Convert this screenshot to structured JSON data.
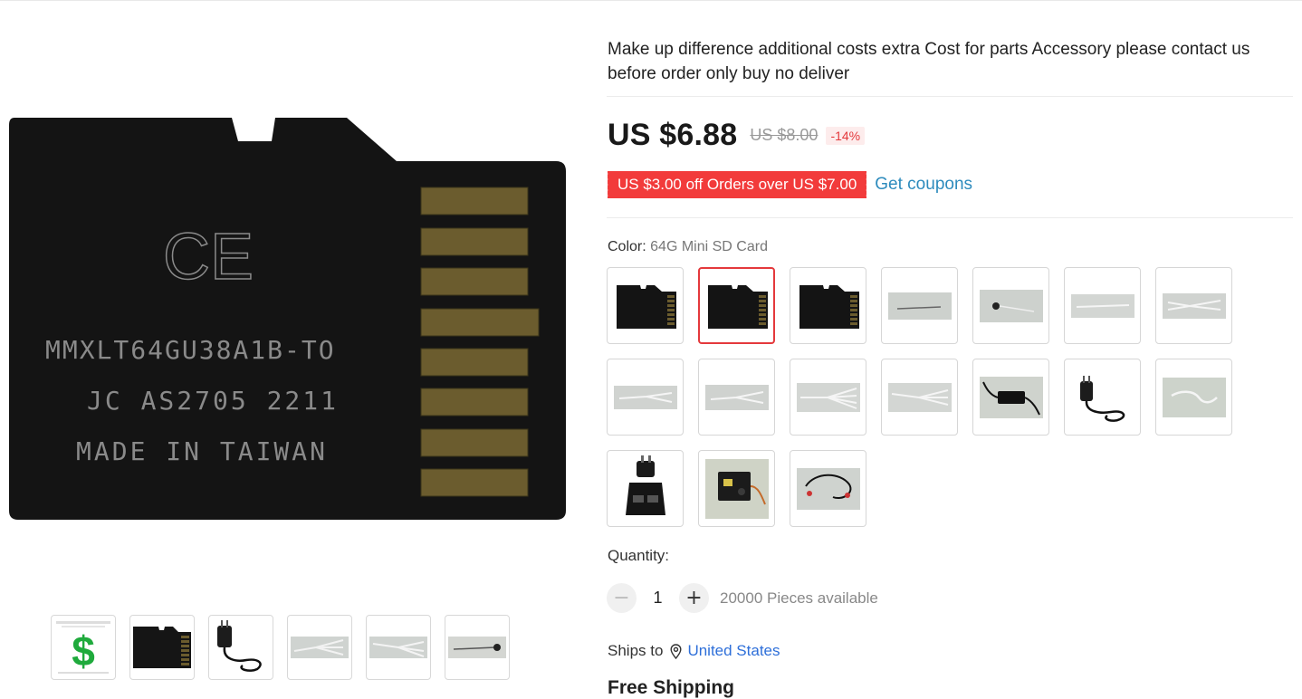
{
  "product": {
    "title": "Make up difference additional costs extra Cost for parts Accessory please contact us before order only buy no deliver",
    "price": "US $6.88",
    "original_price": "US $8.00",
    "discount": "-14%",
    "coupon_text": "US $3.00 off Orders over US $7.00",
    "get_coupons_label": "Get coupons",
    "accent_color": "#e4393c",
    "link_color": "#2d8bbd"
  },
  "main_image": {
    "card_lines": [
      "MMXLT64GU38A1B-TO",
      "JC AS2705 2211",
      "MADE IN TAIWAN"
    ],
    "ce_mark": "CE"
  },
  "thumbnails": [
    {
      "name": "dollar",
      "icon": "dollar-sign-icon",
      "symbol": "$"
    },
    {
      "name": "sd-card",
      "icon": "sd-card-icon"
    },
    {
      "name": "adapter",
      "icon": "power-adapter-icon"
    },
    {
      "name": "cable-splitter",
      "icon": "cable-icon"
    },
    {
      "name": "cable-multi",
      "icon": "cable-icon"
    },
    {
      "name": "cable-sensor",
      "icon": "cable-icon"
    }
  ],
  "color": {
    "label": "Color:",
    "selected_value": "64G Mini SD Card",
    "options": [
      {
        "type": "sd-card",
        "selected": false
      },
      {
        "type": "sd-card",
        "selected": true
      },
      {
        "type": "sd-card",
        "selected": false
      },
      {
        "type": "cable-single",
        "selected": false
      },
      {
        "type": "cable-mic",
        "selected": false
      },
      {
        "type": "cable-long",
        "selected": false
      },
      {
        "type": "cable-splitter",
        "selected": false
      },
      {
        "type": "cable-splitter",
        "selected": false
      },
      {
        "type": "cable-splitter",
        "selected": false
      },
      {
        "type": "cable-multi",
        "selected": false
      },
      {
        "type": "cable-multi",
        "selected": false
      },
      {
        "type": "car-charger",
        "selected": false
      },
      {
        "type": "power-adapter",
        "selected": false
      },
      {
        "type": "cable-coil",
        "selected": false
      },
      {
        "type": "poe-injector",
        "selected": false
      },
      {
        "type": "board",
        "selected": false
      },
      {
        "type": "mic-cable",
        "selected": false
      }
    ]
  },
  "quantity": {
    "label": "Quantity:",
    "value": "1",
    "available": "20000 Pieces available",
    "minus_symbol": "−",
    "plus_symbol": "+"
  },
  "shipping": {
    "ships_to_label": "Ships to",
    "country": "United States",
    "free_shipping": "Free Shipping"
  }
}
